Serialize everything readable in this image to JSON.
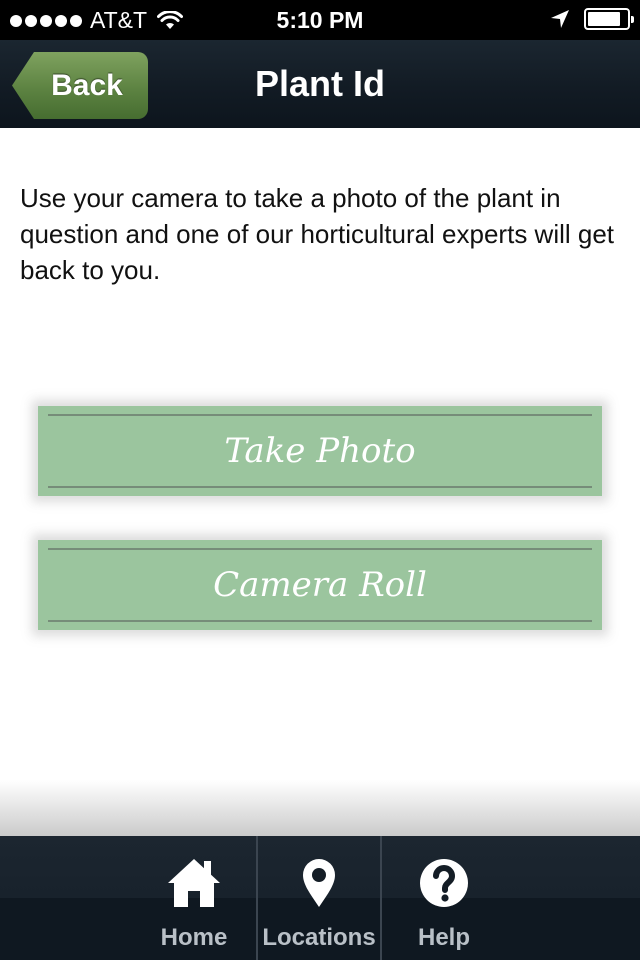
{
  "status_bar": {
    "carrier": "AT&T",
    "time": "5:10 PM",
    "signal_bars": 5,
    "battery_level": 0.85,
    "icons": [
      "signal-icon",
      "wifi-icon",
      "location-arrow-icon",
      "battery-icon"
    ]
  },
  "nav": {
    "back_label": "Back",
    "title": "Plant Id",
    "back_color": "#5d8342"
  },
  "content": {
    "intro_text": "Use your camera to take a photo of the plant in question and one of our horticultural experts will get back to you.",
    "buttons": [
      {
        "label": "Take Photo"
      },
      {
        "label": "Camera Roll"
      }
    ],
    "button_color": "#9bc59e"
  },
  "tab_bar": {
    "items": [
      {
        "label": "Home",
        "icon": "home-icon"
      },
      {
        "label": "Locations",
        "icon": "location-pin-icon"
      },
      {
        "label": "Help",
        "icon": "help-icon"
      }
    ]
  }
}
